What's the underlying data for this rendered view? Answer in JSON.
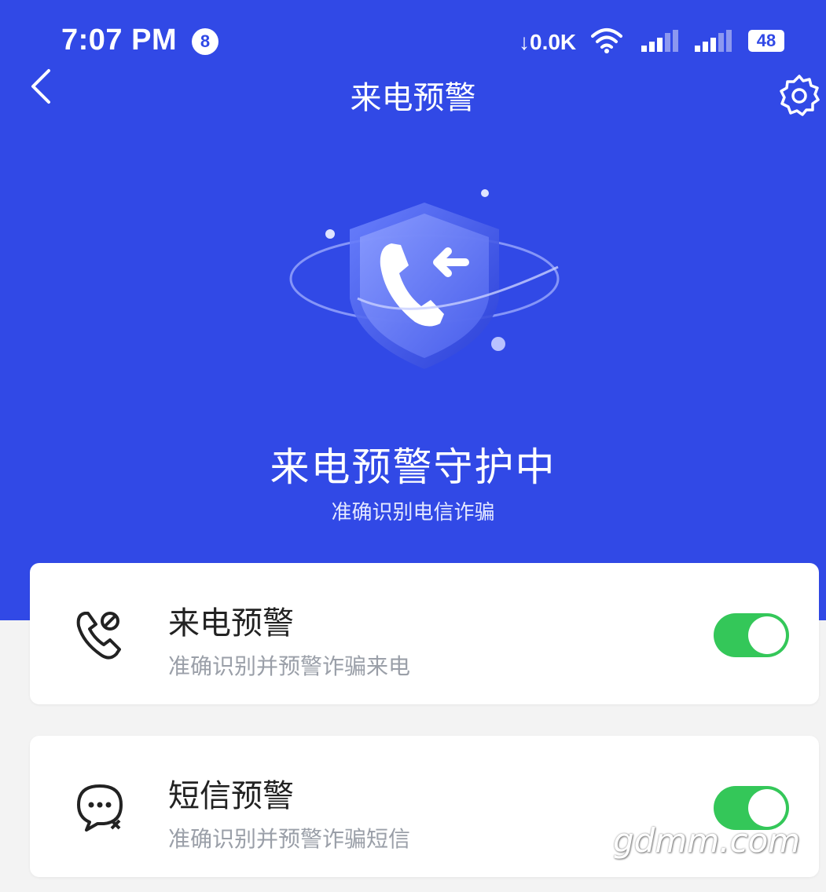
{
  "status_bar": {
    "time": "7:07 PM",
    "notification_count": "8",
    "net_speed": "↓0.0K",
    "battery": "48"
  },
  "header": {
    "title": "来电预警"
  },
  "hero": {
    "title": "来电预警守护中",
    "subtitle": "准确识别电信诈骗"
  },
  "settings": [
    {
      "title": "来电预警",
      "desc": "准确识别并预警诈骗来电",
      "enabled": true,
      "icon": "phone-block-icon"
    },
    {
      "title": "短信预警",
      "desc": "准确识别并预警诈骗短信",
      "enabled": true,
      "icon": "sms-block-icon"
    }
  ],
  "watermark": "gdmm.com",
  "colors": {
    "primary": "#3149e6",
    "toggle_on": "#34c759"
  }
}
